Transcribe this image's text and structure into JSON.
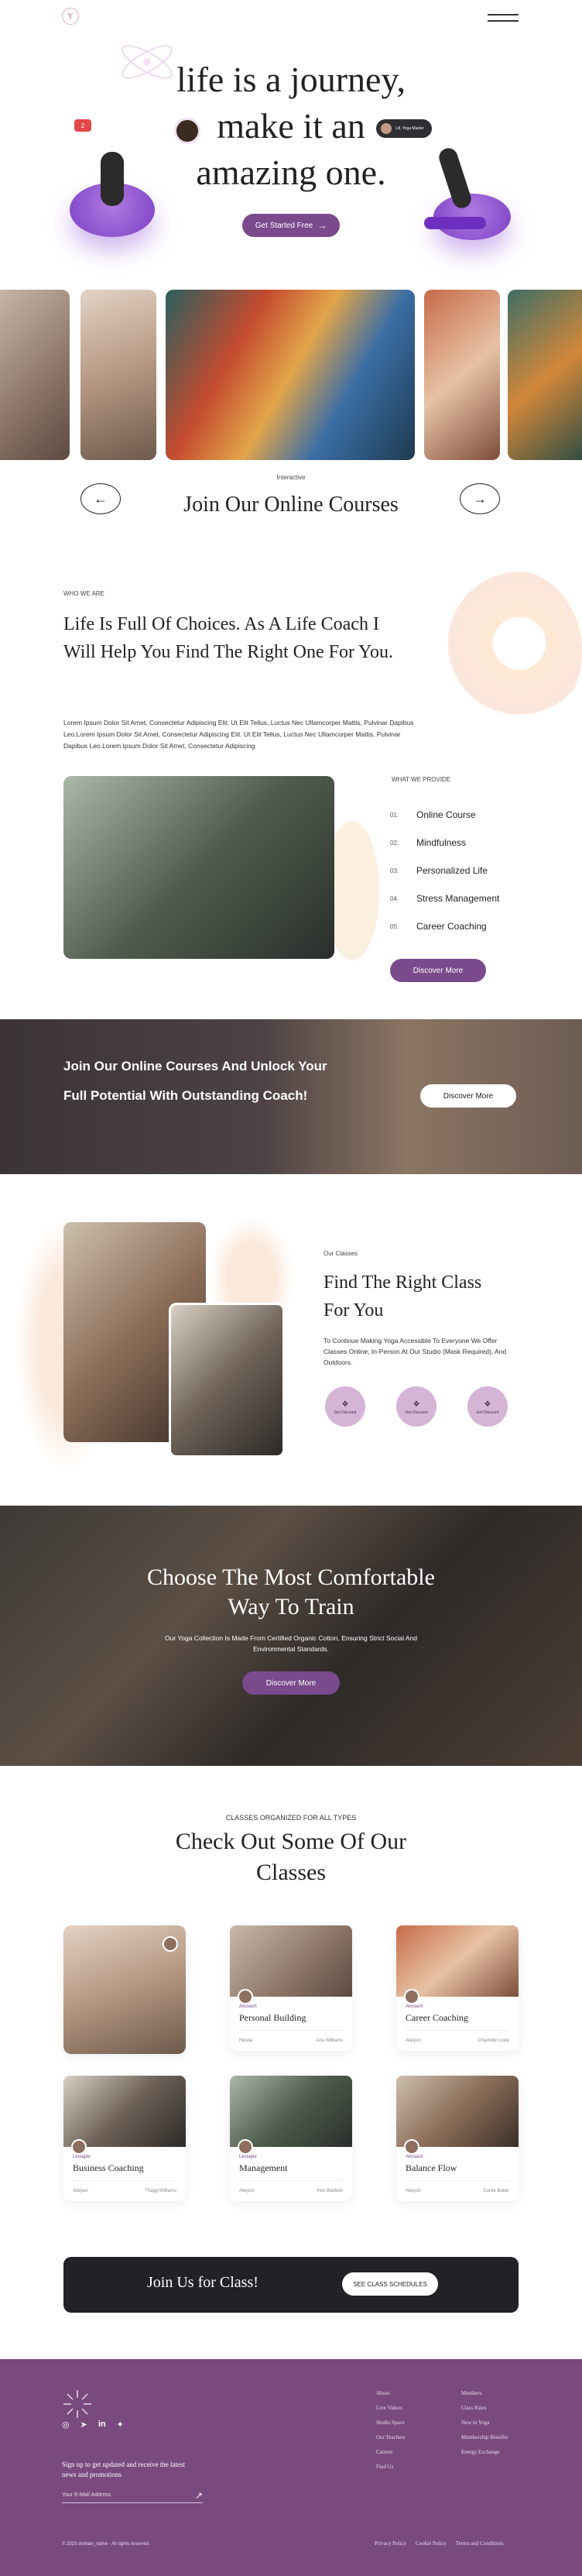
{
  "hero": {
    "headline_line1": "life is a journey,",
    "headline_line2": "make it an",
    "headline_line3": "amazing one.",
    "cta_label": "Get Started Free",
    "mini_chip": "Lili, Yoga Master",
    "notif_count": "2"
  },
  "courses_strip": {
    "kicker": "Interactive",
    "title": "Join Our Online Courses"
  },
  "about": {
    "kicker": "WHO WE ARE",
    "heading": "Life Is Full Of Choices. As A Life Coach I Will Help You Find The Right One For You.",
    "body": "Lorem Ipsum Dolor Sit Amet, Consectetur Adipiscing Elit. Ut Elit Tellus, Luctus Nec Ullamcorper Mattis, Pulvinar Dapibus Leo.Lorem Ipsum Dolor Sit Amet, Consectetur Adipiscing Elit. Ut Elit Tellus, Luctus Nec Ullamcorper Mattis, Pulvinar Dapibus Leo.Lorem Ipsum Dolor Sit Amet, Consectetur Adipiscing",
    "provide_kicker": "WHAT WE PROVIDE",
    "provide_items": [
      {
        "num": "01.",
        "label": "Online Course"
      },
      {
        "num": "02.",
        "label": "Mindfulness"
      },
      {
        "num": "03.",
        "label": "Personalized Life"
      },
      {
        "num": "04.",
        "label": "Stress Management"
      },
      {
        "num": "05.",
        "label": "Career Coaching"
      }
    ],
    "discover_label": "Discover More"
  },
  "banner": {
    "text": "Join Our Online Courses And Unlock Your Full Potential With Outstanding Coach!",
    "button": "Discover More"
  },
  "find_class": {
    "kicker": "Our Classes",
    "title": "Find The Right Class For You",
    "body": "To Continue Making Yoga Accessible To Everyone We Offer Classes Online, In-Person At Our Studio (Mask Required), And Outdoors.",
    "badges": [
      "Get Discount",
      "Get Discount",
      "Get Discount"
    ]
  },
  "comfortable": {
    "title": "Choose The Most Comfortable Way To Train",
    "body": "Our Yoga Collection Is Made From Certified Organic Cotton, Ensuring Strict Social And Environmental Standards.",
    "button": "Discover More"
  },
  "classes": {
    "kicker": "CLASSES ORGANIZED FOR ALL TYPES",
    "title": "Check Out Some Of Our Classes",
    "cards": [
      {
        "tag": "",
        "title": "",
        "meta_left": "",
        "meta_right": ""
      },
      {
        "tag": "Allcoach",
        "title": "Personal Building",
        "meta_left": "Hestia",
        "meta_right": "Ana Williams"
      },
      {
        "tag": "Allcoach",
        "title": "Career Coaching",
        "meta_left": "Alleyon",
        "meta_right": "Charlotte Lowe"
      },
      {
        "tag": "Lestaple",
        "title": "Business Coaching",
        "meta_left": "Alleyon",
        "meta_right": "Thagg Williams"
      },
      {
        "tag": "Lestaple",
        "title": "Management",
        "meta_left": "Alleyon",
        "meta_right": "Ken Baldwin"
      },
      {
        "tag": "Allcoach",
        "title": "Balance Flow",
        "meta_left": "Alleyon",
        "meta_right": "Corde Baker"
      }
    ]
  },
  "join_bar": {
    "text": "Join Us for Class!",
    "button": "SEE CLASS SCHEDULES"
  },
  "footer": {
    "signup_text": "Sign up to get updated and receive the latest news and promotions",
    "email_placeholder": "Your E-Mail Address",
    "col1": [
      "About",
      "Live Videos",
      "Studio Space",
      "Our Teachers",
      "Careers",
      "Find Us"
    ],
    "col2": [
      "Members",
      "Class Rates",
      "New to Yoga",
      "Membership Benefits",
      "Energy Exchange"
    ],
    "copyright": "© 2023 domain_name - All rights reserved",
    "links": [
      "Privacy Policy",
      "Cookie Policy",
      "Terms and Conditions"
    ]
  },
  "colors": {
    "brand_purple": "#7a4a8c",
    "footer_bg": "#7a4a7f",
    "dark_bar": "#222226"
  }
}
